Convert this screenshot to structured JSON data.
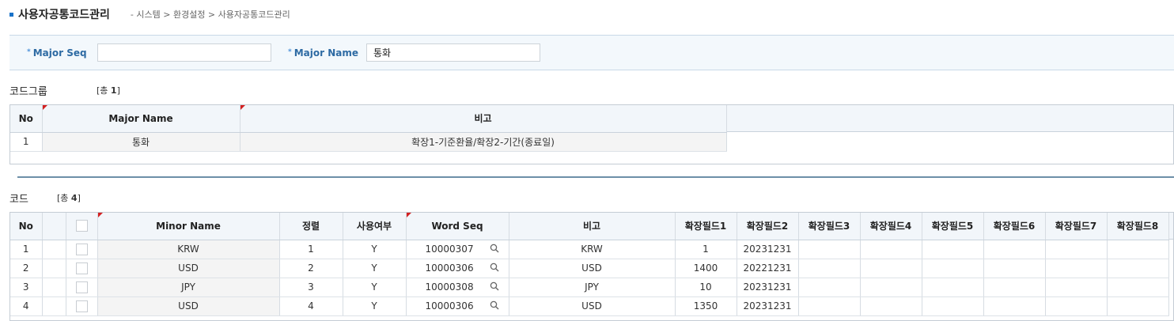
{
  "header": {
    "title": "사용자공통코드관리",
    "breadcrumb": "- 시스템 > 환경설정 > 사용자공통코드관리"
  },
  "search": {
    "major_seq_label": "Major Seq",
    "major_seq_value": "",
    "major_name_label": "Major Name",
    "major_name_value": "통화"
  },
  "group_section": {
    "title": "코드그룹",
    "count_prefix": "[총 ",
    "count": "1",
    "count_suffix": "]",
    "columns": [
      "No",
      "Major Name",
      "비고"
    ],
    "rows": [
      {
        "no": "1",
        "major_name": "통화",
        "note": "확장1-기준환율/확장2-기간(종료일)"
      }
    ]
  },
  "code_section": {
    "title": "코드",
    "count_prefix": "[총 ",
    "count": "4",
    "count_suffix": "]",
    "columns": [
      "No",
      "",
      "",
      "Minor Name",
      "정렬",
      "사용여부",
      "Word Seq",
      "비고",
      "확장필드1",
      "확장필드2",
      "확장필드3",
      "확장필드4",
      "확장필드5",
      "확장필드6",
      "확장필드7",
      "확장필드8"
    ],
    "rows": [
      {
        "no": "1",
        "minor_name": "KRW",
        "sort": "1",
        "use": "Y",
        "word_seq": "10000307",
        "note": "KRW",
        "ext1": "1",
        "ext2": "20231231"
      },
      {
        "no": "2",
        "minor_name": "USD",
        "sort": "2",
        "use": "Y",
        "word_seq": "10000306",
        "note": "USD",
        "ext1": "1400",
        "ext2": "20221231"
      },
      {
        "no": "3",
        "minor_name": "JPY",
        "sort": "3",
        "use": "Y",
        "word_seq": "10000308",
        "note": "JPY",
        "ext1": "10",
        "ext2": "20231231"
      },
      {
        "no": "4",
        "minor_name": "USD",
        "sort": "4",
        "use": "Y",
        "word_seq": "10000306",
        "note": "USD",
        "ext1": "1350",
        "ext2": "20231231"
      }
    ]
  },
  "icons": {
    "title_marker": "square-bullet-icon",
    "required_marker": "asterisk-icon",
    "edit_marker": "red-corner-icon",
    "lookup": "magnifier-icon"
  },
  "colors": {
    "accent": "#1a73c9",
    "label": "#2d6aa3",
    "header_bg": "#f2f6fa",
    "required_mark": "#d32020",
    "divider": "#6d8fa8"
  }
}
